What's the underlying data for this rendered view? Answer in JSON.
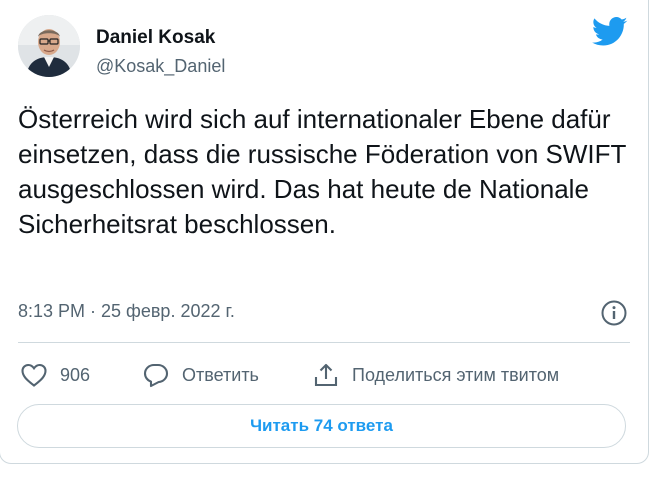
{
  "author": {
    "name": "Daniel Kosak",
    "handle": "@Kosak_Daniel"
  },
  "tweet": {
    "text": "Österreich wird sich auf internationaler Ebene dafür einsetzen, dass die russische Föderation von SWIFT ausgeschlossen wird. Das hat heute de Nationale Sicherheitsrat beschlossen.",
    "timestamp": "8:13 PM · 25 февр. 2022 г."
  },
  "actions": {
    "like_count": "906",
    "reply_label": "Ответить",
    "share_label": "Поделиться этим твитом"
  },
  "read_replies_label": "Читать 74 ответа",
  "icons": {
    "logo": "twitter-bird-icon",
    "info": "info-icon",
    "like": "heart-icon",
    "reply": "speech-bubble-icon",
    "share": "share-upload-icon"
  },
  "colors": {
    "accent": "#1d9bf0",
    "text": "#0f1419",
    "secondary": "#536471",
    "border": "#cfd9de"
  }
}
